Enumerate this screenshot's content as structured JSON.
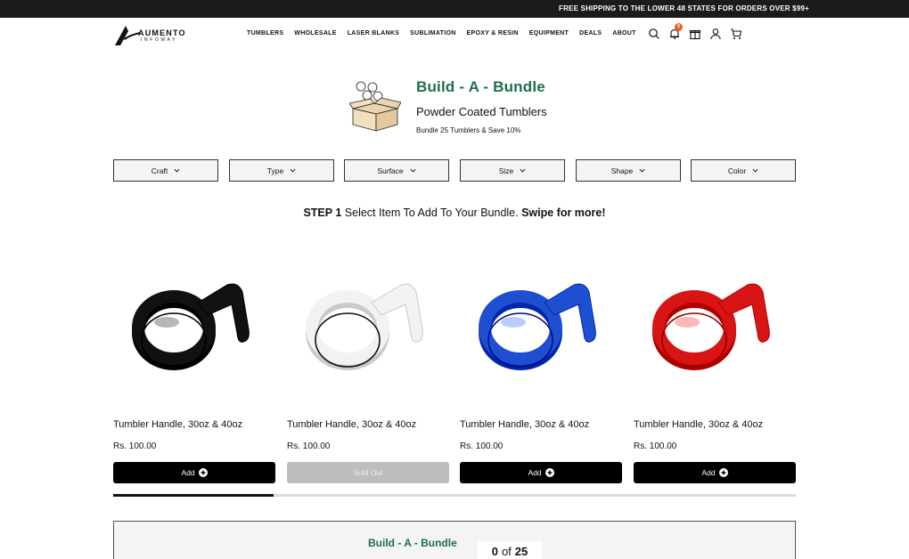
{
  "announcement": "FREE SHIPPING TO THE LOWER 48 STATES FOR ORDERS OVER $99+",
  "logo": {
    "name": "AUMENTO",
    "sub": "INFOWAY"
  },
  "nav": [
    "TUMBLERS",
    "WHOLESALE",
    "LASER BLANKS",
    "SUBLIMATION",
    "EPOXY & RESIN",
    "EQUIPMENT",
    "DEALS",
    "ABOUT"
  ],
  "header_icons": {
    "search": "search-icon",
    "notifications": "bell-icon",
    "notifications_count": "5",
    "gift": "gift-icon",
    "account": "user-icon",
    "cart": "cart-icon"
  },
  "hero": {
    "title": "Build - A - Bundle",
    "subtitle": "Powder Coated Tumblers",
    "note": "Bundle 25 Tumblers & Save 10%"
  },
  "filters": [
    "Craft",
    "Type",
    "Surface",
    "Size",
    "Shape",
    "Color"
  ],
  "step": {
    "label": "STEP 1",
    "text": " Select Item To Add To Your Bundle. ",
    "emphasis": "Swipe for more!"
  },
  "products": [
    {
      "name": "Tumbler Handle, 30oz & 40oz",
      "price": "Rs. 100.00",
      "button": "Add",
      "sold_out": false,
      "color": "#111111"
    },
    {
      "name": "Tumbler Handle, 30oz & 40oz",
      "price": "Rs. 100.00",
      "button": "Sold Out",
      "sold_out": true,
      "color": "#f2f2f2"
    },
    {
      "name": "Tumbler Handle, 30oz & 40oz",
      "price": "Rs. 100.00",
      "button": "Add",
      "sold_out": false,
      "color": "#1f4fd1"
    },
    {
      "name": "Tumbler Handle, 30oz & 40oz",
      "price": "Rs. 100.00",
      "button": "Add",
      "sold_out": false,
      "color": "#d81414"
    }
  ],
  "carousel_progress": 0.235,
  "bundle": {
    "title": "Build - A - Bundle",
    "count": "0",
    "of": "of",
    "total": "25"
  },
  "colors": {
    "accent_green": "#1f6e4a",
    "topbar": "#1b1b1b",
    "button": "#000000",
    "sold_out": "#bdbdbd",
    "badge": "#f05a28"
  }
}
